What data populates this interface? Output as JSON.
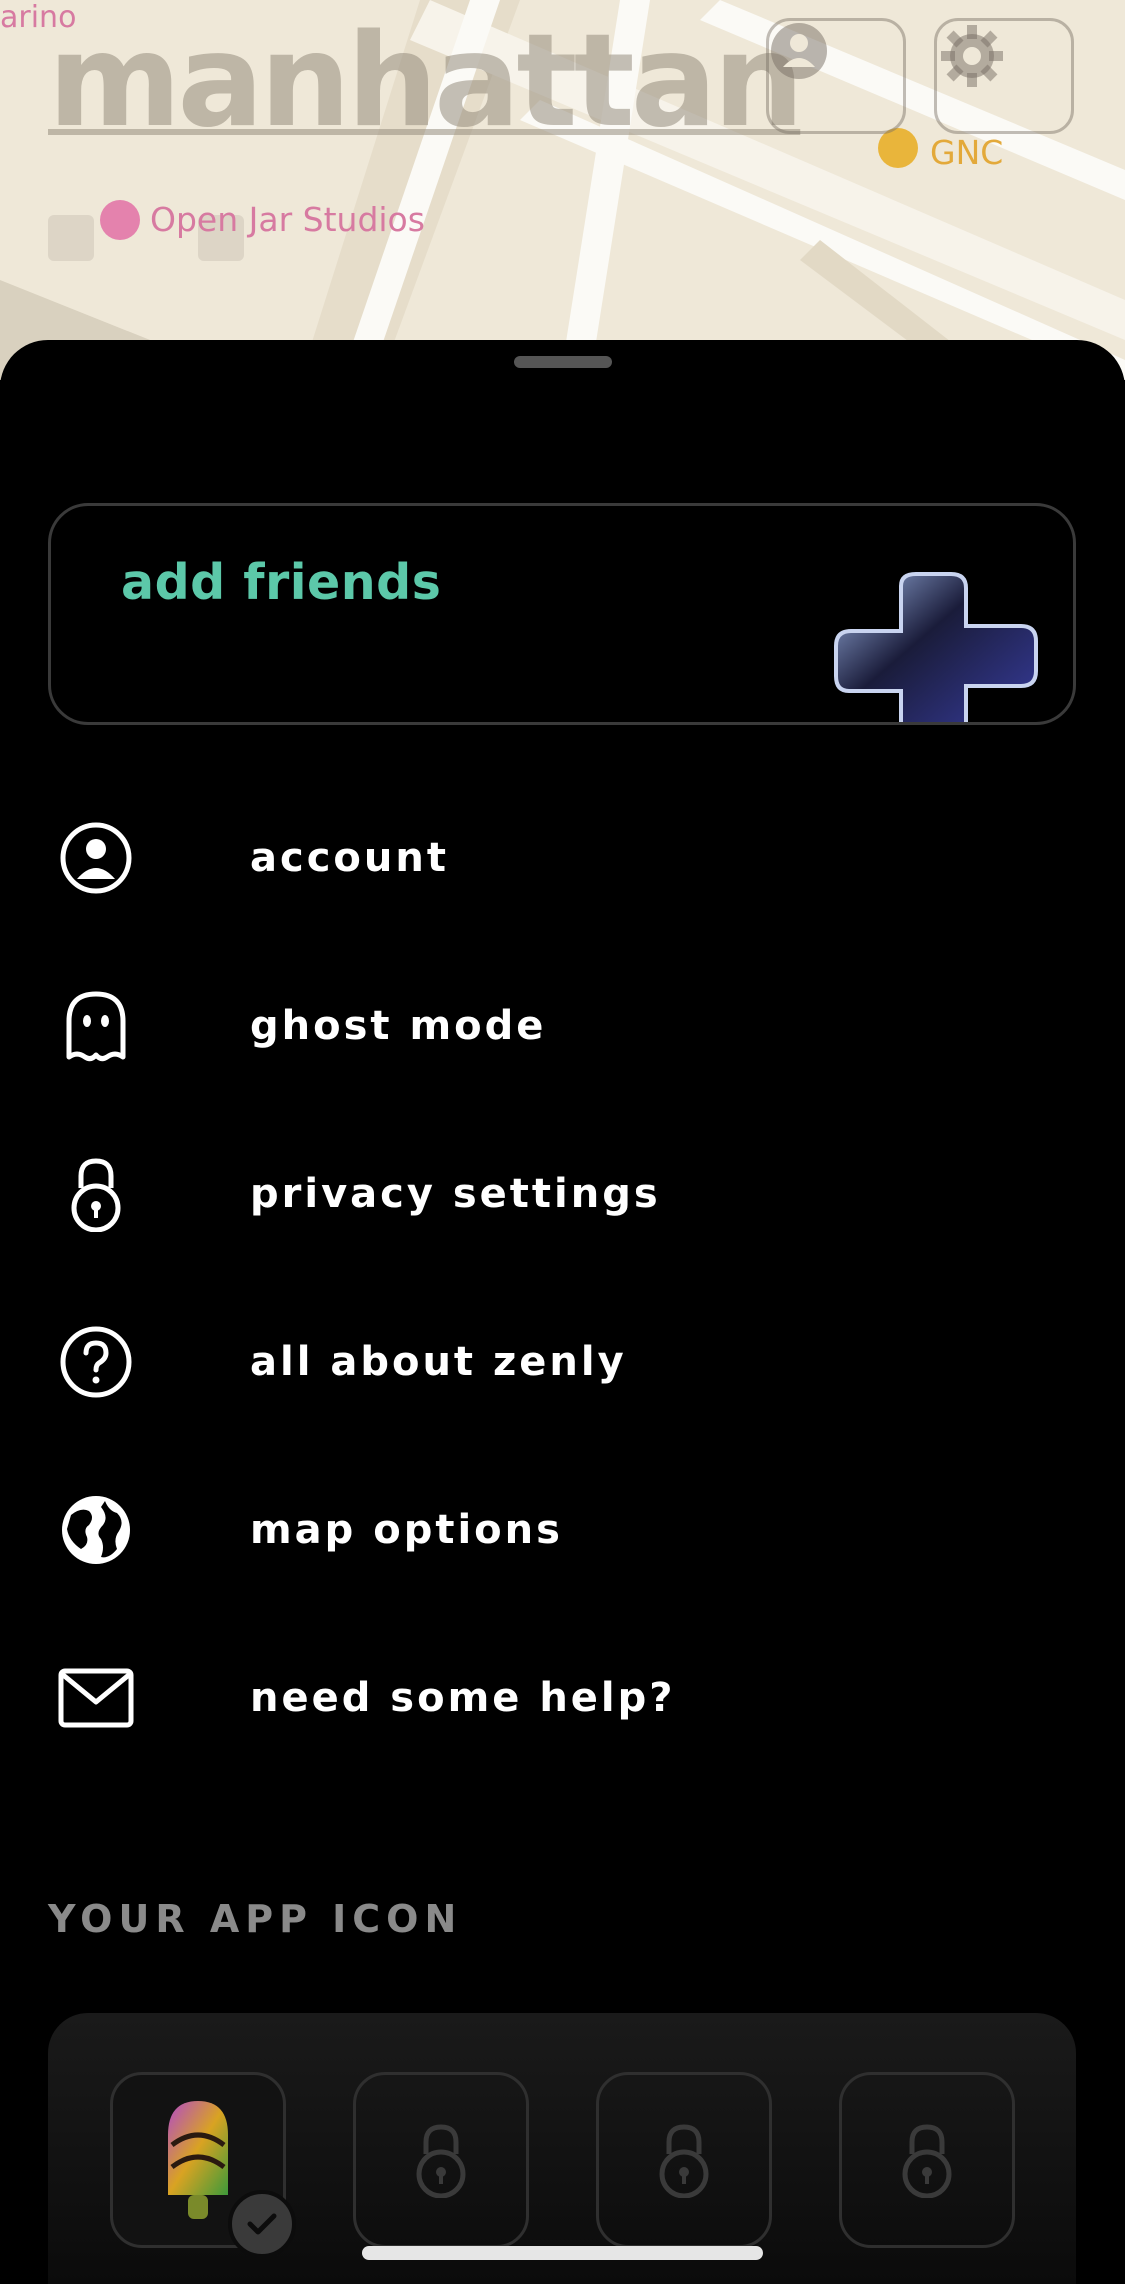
{
  "map": {
    "city_label": "manhattan",
    "labels": {
      "arino": "arino",
      "open_jar": "Open Jar Studios",
      "gnc": "GNC"
    },
    "buttons": {
      "profile": "person-icon",
      "settings": "gear-icon"
    }
  },
  "sheet": {
    "add_friends": "add friends",
    "menu": [
      {
        "label": "account",
        "icon": "account-icon"
      },
      {
        "label": "ghost mode",
        "icon": "ghost-icon"
      },
      {
        "label": "privacy settings",
        "icon": "lock-icon"
      },
      {
        "label": "all about zenly",
        "icon": "question-icon"
      },
      {
        "label": "map options",
        "icon": "globe-icon"
      },
      {
        "label": "need some help?",
        "icon": "mail-icon"
      }
    ],
    "app_icon_section": "YOUR APP ICON",
    "app_icons": [
      {
        "state": "selected",
        "icon": "app-icon"
      },
      {
        "state": "locked",
        "icon": "lock-icon"
      },
      {
        "state": "locked",
        "icon": "lock-icon"
      },
      {
        "state": "locked",
        "icon": "lock-icon"
      }
    ]
  },
  "colors": {
    "accent": "#5cc8a9",
    "background": "#000000"
  }
}
